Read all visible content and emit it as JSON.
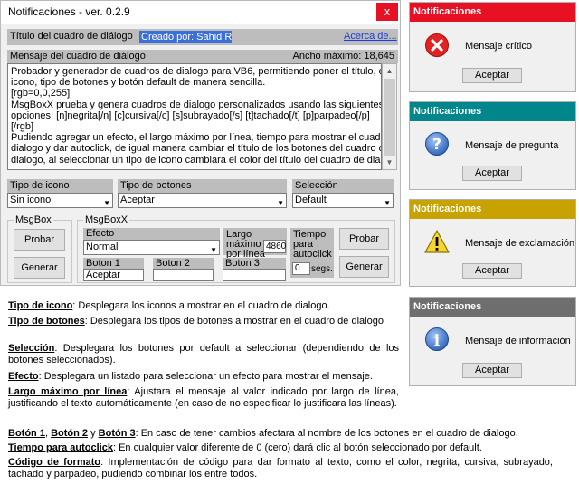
{
  "main": {
    "window_title": "Notificaciones - ver. 0.2.9",
    "close_glyph": "x",
    "title_label": "Título del cuadro de diálogo",
    "title_value": "Creado por: Sahid Ra",
    "about_link": "Acerca de...",
    "message_label": "Mensaje del cuadro de diálogo",
    "max_width": "Ancho máximo: 18,645",
    "message_lines": [
      "Probador y generador de cuadros de dialogo para VB6, permitiendo poner el título, el",
      "icono, tipo de botones y botón default de manera sencilla.",
      "[rgb=0,0,255]",
      "MsgBoxX prueba y genera cuadros de dialogo personalizados usando las siguientes",
      "opciones: [n]negrita[/n] [c]cursiva[/c] [s]subrayado[/s] [t]tachado[/t] [p]parpadeo[/p]",
      "[/rgb]",
      "Pudiendo agregar un efecto, el largo máximo por línea, tiempo para mostrar el cuadro de",
      "dialogo y dar autoclick, de igual manera cambiar el título de los botones del cuadro de",
      "dialogo, al seleccionar un tipo de icono cambiara el color del título del cuadro de dialogo."
    ],
    "icon_type_label": "Tipo de icono",
    "icon_type_value": "Sin icono",
    "button_type_label": "Tipo de botones",
    "button_type_value": "Aceptar",
    "selection_label": "Selección",
    "selection_value": "Default",
    "msgbox_group": "MsgBox",
    "msgbox_probar": "Probar",
    "msgbox_generar": "Generar",
    "msgboxx_group": "MsgBoxX",
    "effect_label": "Efecto",
    "effect_value": "Normal",
    "max_line_label": "Largo máximo por línea",
    "max_line_value": "4860",
    "autoclick_label": "Tiempo para autoclick",
    "autoclick_value": "0",
    "autoclick_unit": "segs.",
    "button1_label": "Boton 1",
    "button1_value": "Aceptar",
    "button2_label": "Boton 2",
    "button2_value": "",
    "button3_label": "Boton 3",
    "button3_value": "",
    "msgboxx_probar": "Probar",
    "msgboxx_generar": "Generar"
  },
  "boxes": [
    {
      "title": "Notificaciones",
      "message": "Mensaje crítico",
      "button": "Aceptar",
      "color": "#e81123",
      "icon": "critical-icon"
    },
    {
      "title": "Notificaciones",
      "message": "Mensaje de pregunta",
      "button": "Aceptar",
      "color": "#00868b",
      "icon": "question-icon"
    },
    {
      "title": "Notificaciones",
      "message": "Mensaje de exclamación",
      "button": "Aceptar",
      "color": "#c8a200",
      "icon": "exclamation-icon"
    },
    {
      "title": "Notificaciones",
      "message": "Mensaje de información",
      "button": "Aceptar",
      "color": "#6e6e6e",
      "icon": "information-icon"
    }
  ],
  "description": [
    {
      "term": "Tipo de icono",
      "text": ": Desplegara los iconos a mostrar en el cuadro de dialogo."
    },
    {
      "term": "Tipo de botones",
      "text": ": Desplegara los tipos de botones a mostrar en el cuadro de dialogo"
    },
    {
      "term": "Selección",
      "text": ": Desplegara los botones por default a seleccionar (dependiendo de los botones seleccionados)."
    },
    {
      "term": "Efecto",
      "text": ": Desplegara un listado para seleccionar un efecto para mostrar el mensaje."
    },
    {
      "term": "Largo máximo por línea",
      "text": ": Ajustara el mensaje al valor indicado por largo de línea, justificando el texto automáticamente (en caso de no especificar lo justificara las líneas)."
    },
    {
      "terms": [
        "Botón 1",
        "Botón 2",
        "Botón 3"
      ],
      "joiners": [
        ", ",
        " y "
      ],
      "text": ": En caso de tener cambios afectara al nombre de los botones en el cuadro de dialogo."
    },
    {
      "term": "Tiempo para autoclick",
      "text": ": En cualquier valor diferente de 0 (cero) dará clic al botón seleccionado por default."
    },
    {
      "term": "Código de formato",
      "text": ": Implementación de código para dar formato al texto, como el color, negrita, cursiva, subrayado, tachado y parpadeo, pudiendo combinar los entre todos."
    }
  ]
}
